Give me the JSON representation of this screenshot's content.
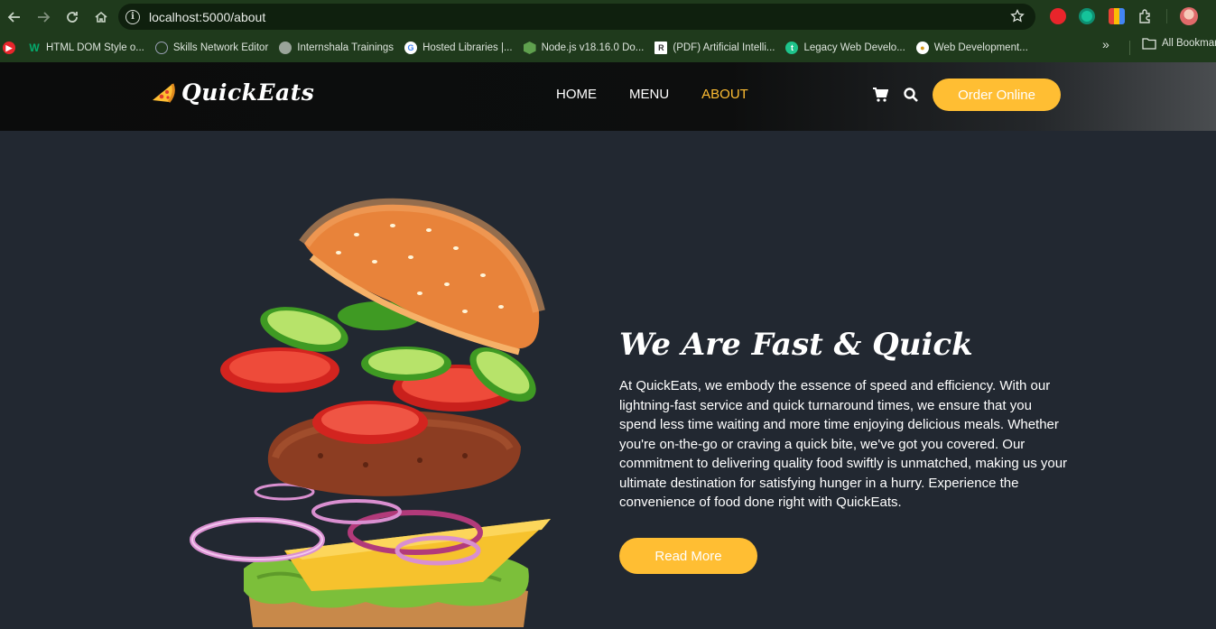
{
  "browser": {
    "url": "localhost:5000/about",
    "bookmarks": [
      {
        "label": "HTML DOM Style o...",
        "icon": "w3schools-icon",
        "color": "#04aa6d"
      },
      {
        "label": "Skills Network Editor",
        "icon": "skills-network-icon",
        "color": "#6b6f80"
      },
      {
        "label": "Internshala Trainings",
        "icon": "globe-icon",
        "color": "#9aa49a"
      },
      {
        "label": "Hosted Libraries |...",
        "icon": "google-icon",
        "color": "#ffffff"
      },
      {
        "label": "Node.js v18.16.0 Do...",
        "icon": "nodejs-icon",
        "color": "#5fa04e"
      },
      {
        "label": "(PDF) Artificial Intelli...",
        "icon": "researchgate-icon",
        "color": "#ffffff"
      },
      {
        "label": "Legacy Web Develo...",
        "icon": "freecodecamp-icon",
        "color": "#1ec38b"
      },
      {
        "label": "Web Development...",
        "icon": "course-icon",
        "color": "#f5d142"
      }
    ],
    "all_bookmarks": "All Bookmarks"
  },
  "site": {
    "logo": "QuickEats",
    "nav": [
      "HOME",
      "MENU",
      "ABOUT"
    ],
    "active_nav": "ABOUT",
    "order_button": "Order Online",
    "accent_color": "#ffbe33"
  },
  "about": {
    "heading": "We Are Fast & Quick",
    "paragraph": "At QuickEats, we embody the essence of speed and efficiency. With our lightning-fast service and quick turnaround times, we ensure that you spend less time waiting and more time enjoying delicious meals. Whether you're on-the-go or craving a quick bite, we've got you covered. Our commitment to delivering quality food swiftly is unmatched, making us your ultimate destination for satisfying hunger in a hurry. Experience the convenience of food done right with QuickEats.",
    "button": "Read More"
  }
}
